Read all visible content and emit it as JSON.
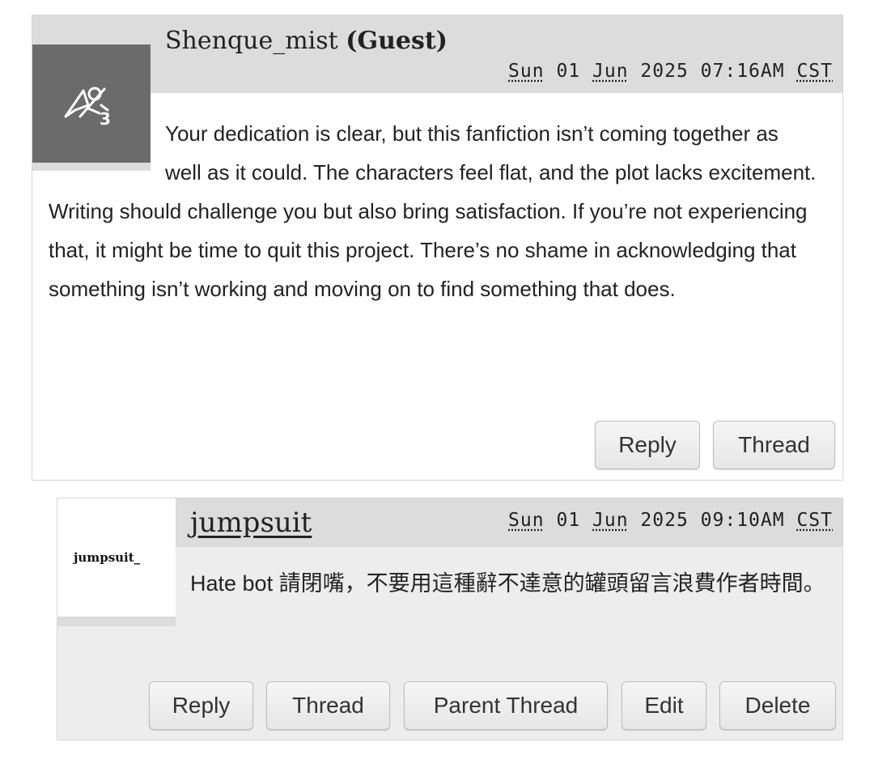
{
  "comments": [
    {
      "username": "Shenque_mist",
      "guest_label": "(Guest)",
      "date": {
        "dow": "Sun",
        "day": "01",
        "month": "Jun",
        "year": "2025",
        "time": "07:16AM",
        "tz": "CST"
      },
      "avatar": {
        "icon": "broken-image-icon",
        "bg": "#6b6b6b"
      },
      "body": "Your dedication is clear, but this fanfiction isn’t coming together as well as it could. The characters feel flat, and the plot lacks excitement. Writing should challenge you but also bring satisfaction. If you’re not experiencing that, it might be time to quit this project. There’s no shame in acknowledging that something isn’t working and moving on to find something that does.",
      "buttons": {
        "reply": "Reply",
        "thread": "Thread"
      }
    },
    {
      "username": "jumpsuit",
      "avatar_text": "jumpsuit_",
      "date": {
        "dow": "Sun",
        "day": "01",
        "month": "Jun",
        "year": "2025",
        "time": "09:10AM",
        "tz": "CST"
      },
      "body": "Hate bot 請閉嘴，不要用這種辭不達意的罐頭留言浪費作者時間。",
      "buttons": {
        "reply": "Reply",
        "thread": "Thread",
        "parent_thread": "Parent Thread",
        "edit": "Edit",
        "delete": "Delete"
      }
    }
  ]
}
